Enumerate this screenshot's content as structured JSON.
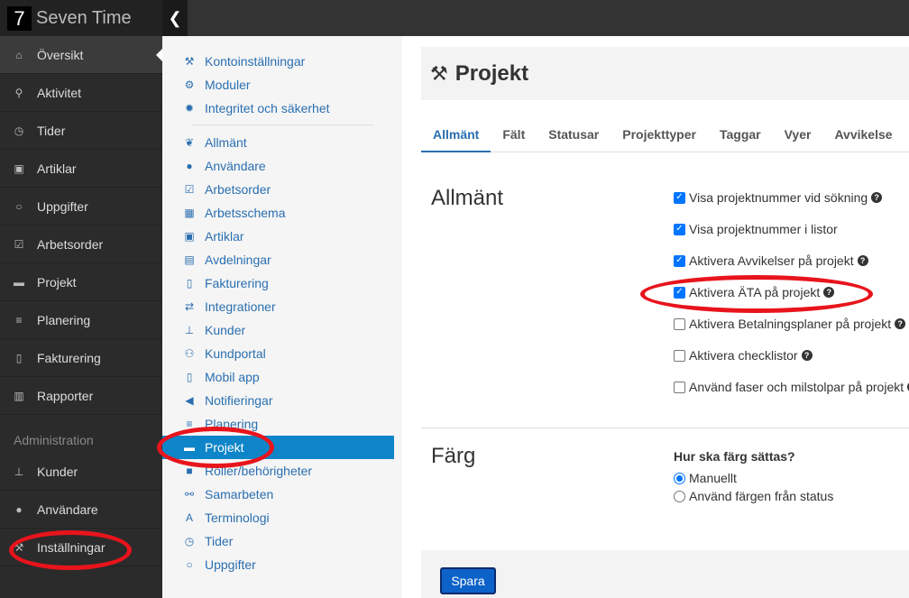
{
  "app": {
    "logo": "7",
    "name": "Seven Time"
  },
  "sidebar": {
    "items": [
      {
        "label": "Översikt",
        "icon": "home-icon",
        "glyph": "⌂"
      },
      {
        "label": "Aktivitet",
        "icon": "map-pin-icon",
        "glyph": "⚲"
      },
      {
        "label": "Tider",
        "icon": "clock-icon",
        "glyph": "◷"
      },
      {
        "label": "Artiklar",
        "icon": "money-icon",
        "glyph": "▣"
      },
      {
        "label": "Uppgifter",
        "icon": "circle-icon",
        "glyph": "○"
      },
      {
        "label": "Arbetsorder",
        "icon": "checkbox-icon",
        "glyph": "☑"
      },
      {
        "label": "Projekt",
        "icon": "briefcase-icon",
        "glyph": "▬"
      },
      {
        "label": "Planering",
        "icon": "align-left-icon",
        "glyph": "≡"
      },
      {
        "label": "Fakturering",
        "icon": "file-icon",
        "glyph": "▯"
      },
      {
        "label": "Rapporter",
        "icon": "bar-chart-icon",
        "glyph": "▥"
      }
    ],
    "section_label": "Administration",
    "admin_items": [
      {
        "label": "Kunder",
        "icon": "sitemap-icon",
        "glyph": "⊥"
      },
      {
        "label": "Användare",
        "icon": "user-icon",
        "glyph": "●"
      },
      {
        "label": "Inställningar",
        "icon": "wrench-icon",
        "glyph": "⚒"
      }
    ]
  },
  "submenu": {
    "group1": [
      {
        "label": "Kontoinställningar",
        "icon": "wrench-icon",
        "glyph": "⚒"
      },
      {
        "label": "Moduler",
        "icon": "cogs-icon",
        "glyph": "⚙"
      },
      {
        "label": "Integritet och säkerhet",
        "icon": "certificate-icon",
        "glyph": "✹"
      }
    ],
    "group2": [
      {
        "label": "Allmänt",
        "icon": "leaf-icon",
        "glyph": "❦"
      },
      {
        "label": "Användare",
        "icon": "user-icon",
        "glyph": "●"
      },
      {
        "label": "Arbetsorder",
        "icon": "checkbox-icon",
        "glyph": "☑"
      },
      {
        "label": "Arbetsschema",
        "icon": "calendar-icon",
        "glyph": "▦"
      },
      {
        "label": "Artiklar",
        "icon": "money-icon",
        "glyph": "▣"
      },
      {
        "label": "Avdelningar",
        "icon": "building-icon",
        "glyph": "▤"
      },
      {
        "label": "Fakturering",
        "icon": "file-icon",
        "glyph": "▯"
      },
      {
        "label": "Integrationer",
        "icon": "exchange-icon",
        "glyph": "⇄"
      },
      {
        "label": "Kunder",
        "icon": "sitemap-icon",
        "glyph": "⊥"
      },
      {
        "label": "Kundportal",
        "icon": "users-icon",
        "glyph": "⚇"
      },
      {
        "label": "Mobil app",
        "icon": "mobile-icon",
        "glyph": "▯"
      },
      {
        "label": "Notifieringar",
        "icon": "bullhorn-icon",
        "glyph": "◀"
      },
      {
        "label": "Planering",
        "icon": "align-left-icon",
        "glyph": "≡"
      },
      {
        "label": "Projekt",
        "icon": "briefcase-icon",
        "glyph": "▬"
      },
      {
        "label": "Roller/behörigheter",
        "icon": "lock-icon",
        "glyph": "■"
      },
      {
        "label": "Samarbeten",
        "icon": "handshake-icon",
        "glyph": "⚯"
      },
      {
        "label": "Terminologi",
        "icon": "font-icon",
        "glyph": "A"
      },
      {
        "label": "Tider",
        "icon": "clock-icon",
        "glyph": "◷"
      },
      {
        "label": "Uppgifter",
        "icon": "circle-icon",
        "glyph": "○"
      }
    ]
  },
  "page": {
    "title": "Projekt",
    "title_icon": "wrench-icon",
    "tabs": [
      "Allmänt",
      "Fält",
      "Statusar",
      "Projekttyper",
      "Taggar",
      "Vyer",
      "Avvikelse"
    ],
    "general": {
      "title": "Allmänt",
      "options": [
        {
          "label": "Visa projektnummer vid sökning",
          "checked": true,
          "help": true
        },
        {
          "label": "Visa projektnummer i listor",
          "checked": true,
          "help": false
        },
        {
          "label": "Aktivera Avvikelser på projekt",
          "checked": true,
          "help": true
        },
        {
          "label": "Aktivera ÄTA på projekt",
          "checked": true,
          "help": true
        },
        {
          "label": "Aktivera Betalningsplaner på projekt",
          "checked": false,
          "help": true
        },
        {
          "label": "Aktivera checklistor",
          "checked": false,
          "help": true
        },
        {
          "label": "Använd faser och milstolpar på projekt",
          "checked": false,
          "help": true
        }
      ]
    },
    "color": {
      "title": "Färg",
      "question": "Hur ska färg sättas?",
      "options": [
        {
          "label": "Manuellt",
          "checked": true
        },
        {
          "label": "Använd färgen från status",
          "checked": false
        }
      ]
    },
    "save_label": "Spara"
  },
  "colors": {
    "accent": "#0e85c9",
    "link": "#2a6fb0",
    "highlight": "#e8141c",
    "save": "#0d62c9"
  }
}
